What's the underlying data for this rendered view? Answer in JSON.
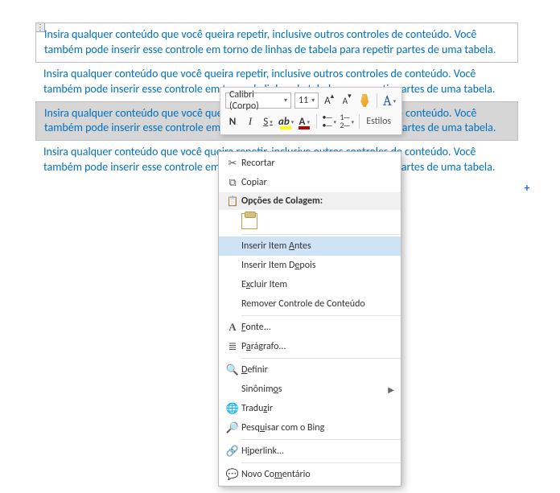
{
  "content_blocks": [
    "Insira qualquer conteúdo que você queira repetir, inclusive outros controles de conteúdo. Você também pode inserir esse controle em torno de linhas de tabela para repetir partes de uma tabela.",
    "Insira qualquer conteúdo que você queira repetir, inclusive outros controles de conteúdo. Você também pode inserir esse controle em torno de linhas de tabela para repetir partes de uma tabela.",
    "Insira qualquer conteúdo que você queira repetir, inclusive outros controles de conteúdo. Você também pode inserir esse controle em torno de linhas de tabela para repetir partes de uma tabela.",
    "Insira qualquer conteúdo que você queira repetir, inclusive outros controles de conteúdo. Você também pode inserir esse controle em torno de linhas de tabela para repetir partes de uma tabela."
  ],
  "mini_toolbar": {
    "font_name": "Calibri (Corpo)",
    "font_size": "11",
    "grow_font": "A",
    "shrink_font": "A",
    "styles_label": "Estilos",
    "bold": "N",
    "italic": "I",
    "underline": "S",
    "highlight_letter": "ab",
    "color_letter": "A"
  },
  "context_menu": {
    "cut": "Recortar",
    "copy": "Copiar",
    "paste_options": "Opções de Colagem:",
    "insert_before_pre": "Inserir Item ",
    "insert_before_m": "A",
    "insert_before_post": "ntes",
    "insert_after_pre": "Inserir Item D",
    "insert_after_m": "e",
    "insert_after_post": "pois",
    "delete_item_pre": "E",
    "delete_item_m": "x",
    "delete_item_post": "cluir Item",
    "remove_control": "Remover Controle de Conteúdo",
    "font_pre": "",
    "font_m": "F",
    "font_post": "onte...",
    "paragraph_pre": "P",
    "paragraph_m": "a",
    "paragraph_post": "rágrafo...",
    "define_pre": "",
    "define_m": "D",
    "define_post": "efinir",
    "synonyms_pre": "Sinônim",
    "synonyms_m": "o",
    "synonyms_post": "s",
    "translate_pre": "Tradu",
    "translate_m": "z",
    "translate_post": "ir",
    "bing_pre": "Pesq",
    "bing_m": "u",
    "bing_post": "isar com o Bing",
    "hyperlink_pre": "H",
    "hyperlink_m": "i",
    "hyperlink_post": "perlink...",
    "comment_pre": "Novo Co",
    "comment_m": "m",
    "comment_post": "entário"
  }
}
